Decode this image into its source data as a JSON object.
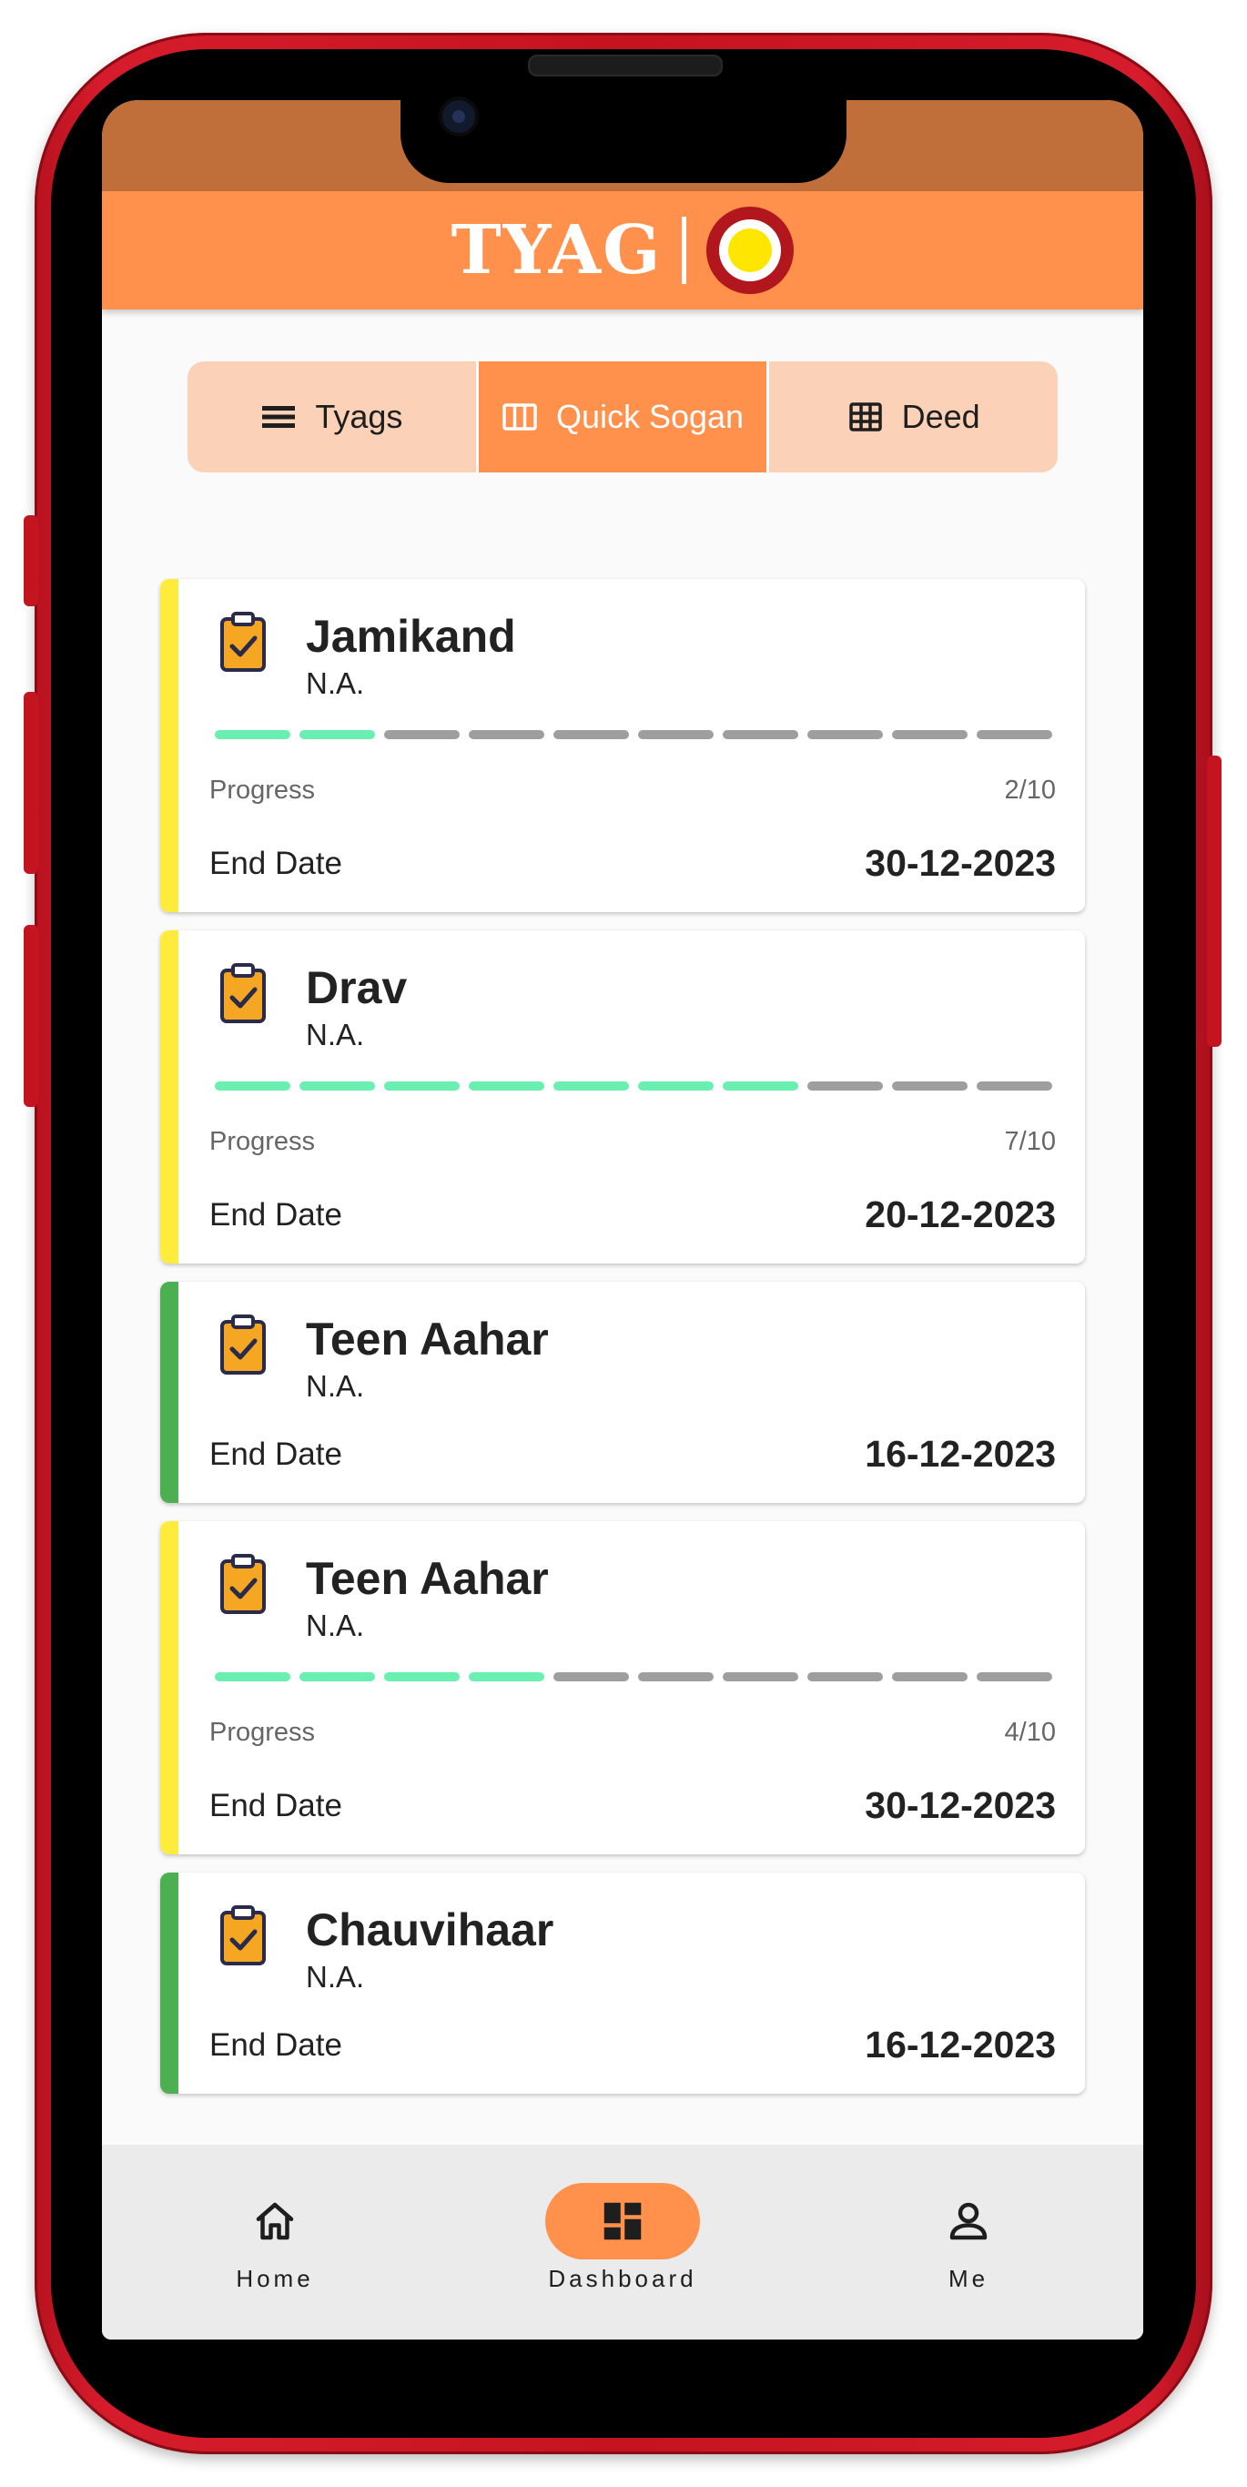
{
  "header": {
    "logo_text": "TYAG"
  },
  "tabs": [
    {
      "label": "Tyags",
      "icon": "list-icon",
      "active": false
    },
    {
      "label": "Quick Sogan",
      "icon": "columns-icon",
      "active": true
    },
    {
      "label": "Deed",
      "icon": "grid-icon",
      "active": false
    }
  ],
  "colors": {
    "brand": "#ff914d",
    "accent_yellow": "#ffeb3b",
    "accent_green": "#4caf50",
    "progress_done": "#69efb0",
    "progress_pending": "#9e9e9e"
  },
  "cards": [
    {
      "title": "Jamikand",
      "subtitle": "N.A.",
      "accent": "yellow",
      "progress_label": "Progress",
      "progress_text": "2/10",
      "progress_done": 2,
      "progress_total": 10,
      "end_label": "End Date",
      "end_date": "30-12-2023"
    },
    {
      "title": "Drav",
      "subtitle": "N.A.",
      "accent": "yellow",
      "progress_label": "Progress",
      "progress_text": "7/10",
      "progress_done": 7,
      "progress_total": 10,
      "end_label": "End Date",
      "end_date": "20-12-2023"
    },
    {
      "title": "Teen Aahar",
      "subtitle": "N.A.",
      "accent": "green",
      "end_label": "End Date",
      "end_date": "16-12-2023"
    },
    {
      "title": "Teen Aahar",
      "subtitle": "N.A.",
      "accent": "yellow",
      "progress_label": "Progress",
      "progress_text": "4/10",
      "progress_done": 4,
      "progress_total": 10,
      "end_label": "End Date",
      "end_date": "30-12-2023"
    },
    {
      "title": "Chauvihaar",
      "subtitle": "N.A.",
      "accent": "green",
      "end_label": "End Date",
      "end_date": "16-12-2023"
    }
  ],
  "bottom_nav": [
    {
      "label": "Home",
      "icon": "home-icon",
      "active": false
    },
    {
      "label": "Dashboard",
      "icon": "dashboard-icon",
      "active": true
    },
    {
      "label": "Me",
      "icon": "person-icon",
      "active": false
    }
  ]
}
